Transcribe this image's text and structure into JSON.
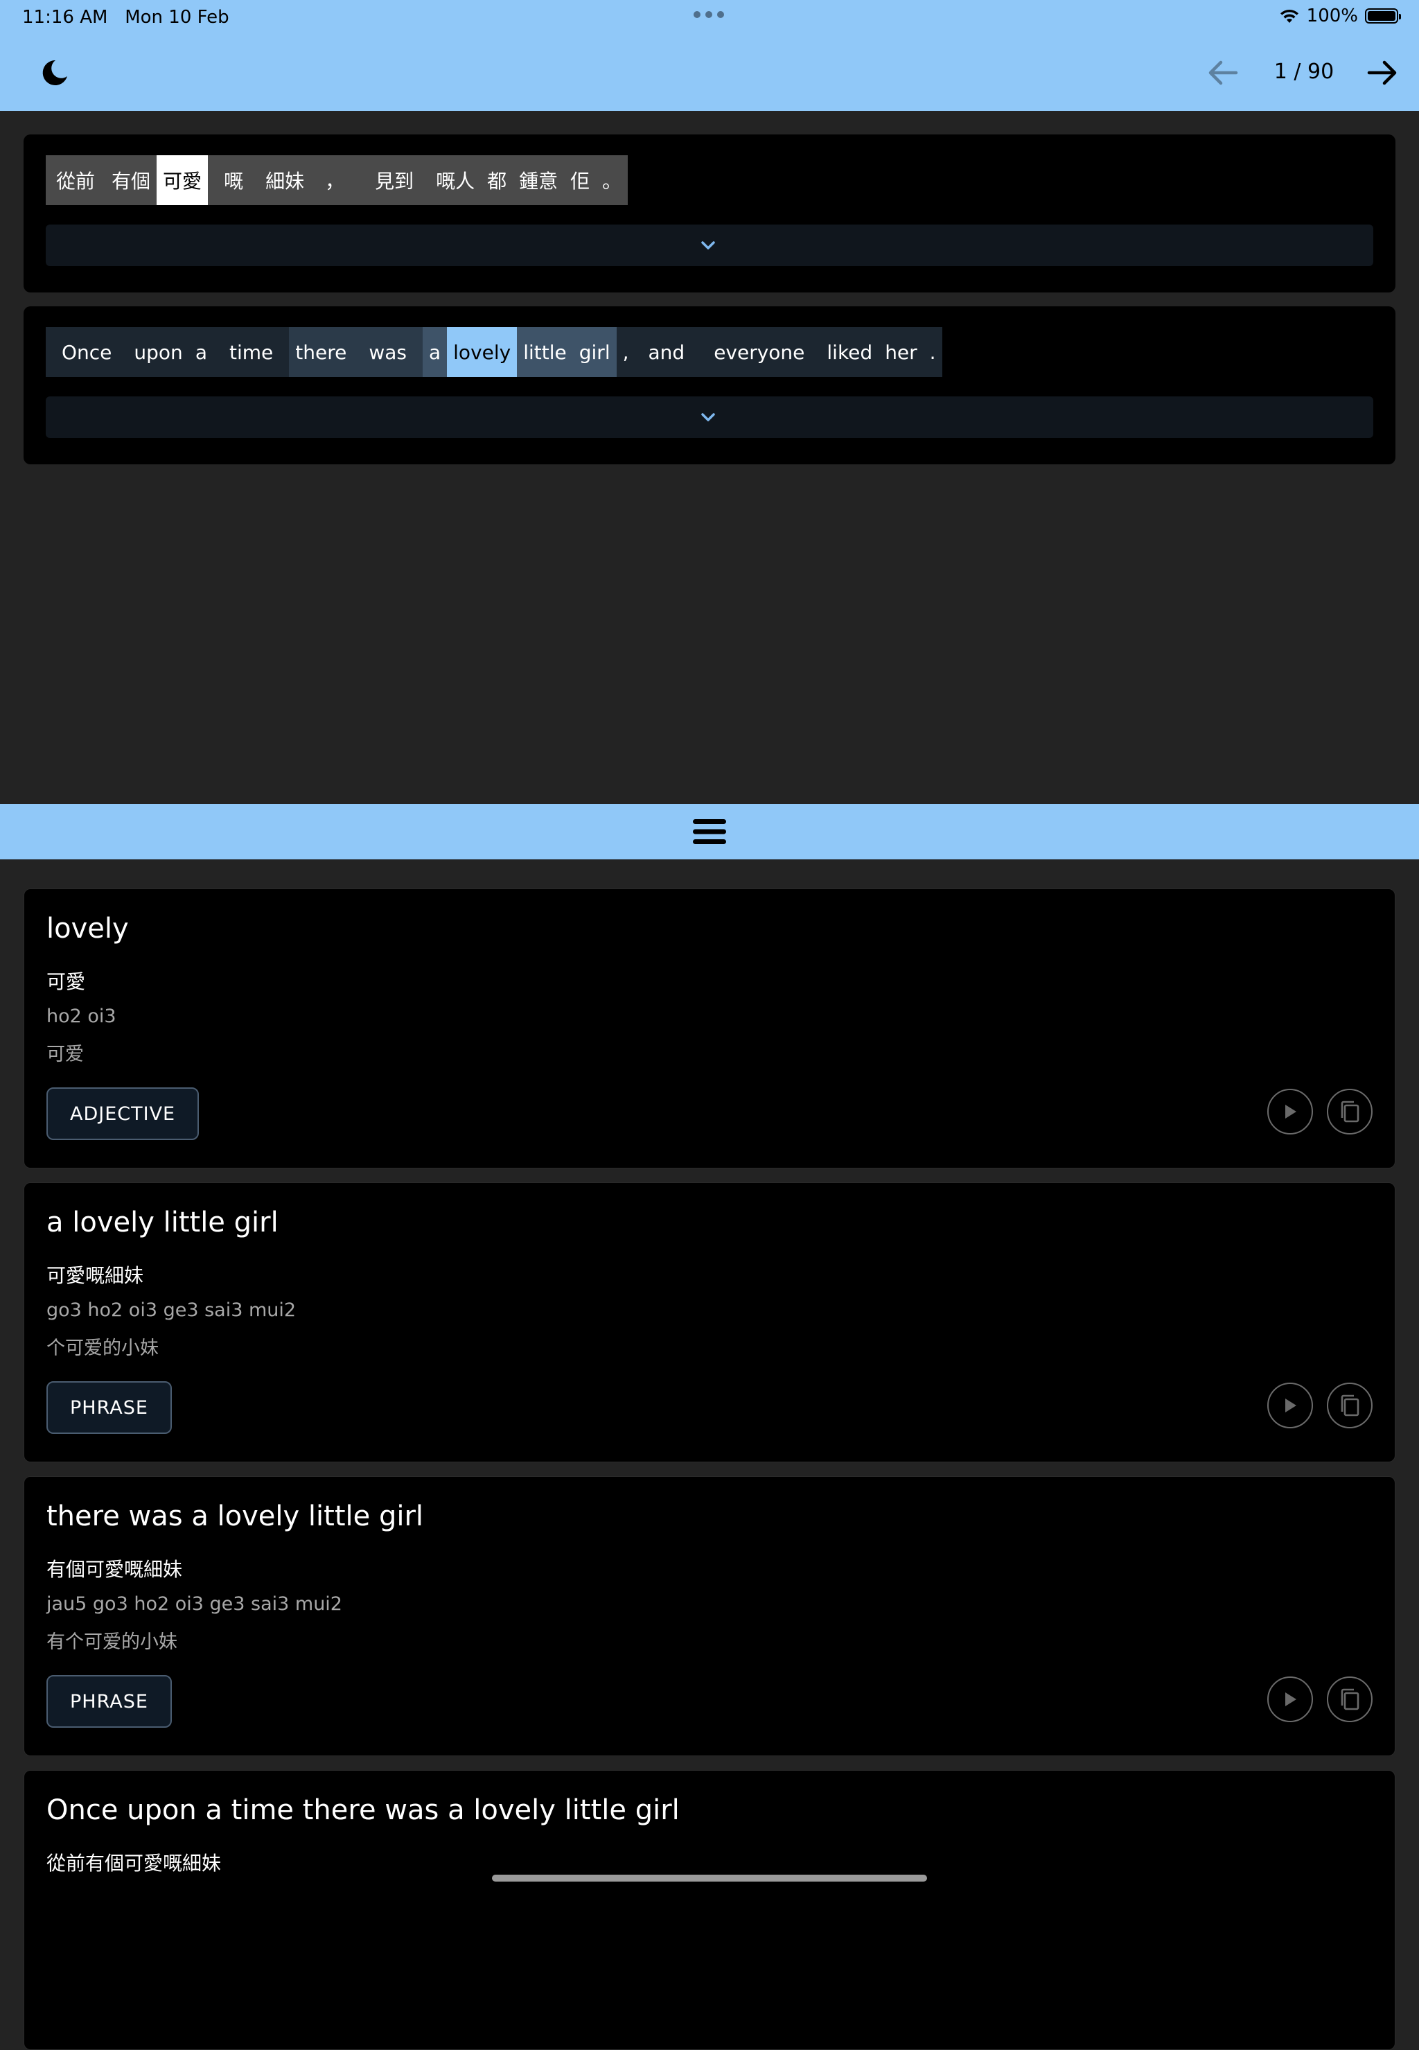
{
  "status_bar": {
    "time": "11:16 AM",
    "date": "Mon 10 Feb",
    "battery": "100%",
    "battery_level": 1.0
  },
  "header": {
    "theme_icon": "moon-icon",
    "prev_icon": "arrow-left-icon",
    "next_icon": "arrow-right-icon",
    "page_counter": "1 / 90"
  },
  "colors": {
    "accent": "#90c8f8",
    "card_bg": "#000000",
    "page_bg": "#232323"
  },
  "sentences": [
    {
      "tokens": [
        {
          "text": "從前",
          "bg": "#4a4a4a",
          "fg": "#ffffff"
        },
        {
          "text": "有個",
          "bg": "#4a4a4a",
          "fg": "#ffffff"
        },
        {
          "text": "可愛",
          "bg": "#ffffff",
          "fg": "#000000"
        },
        {
          "text": "嘅",
          "bg": "#4a4a4a",
          "fg": "#ffffff"
        },
        {
          "text": "細妹",
          "bg": "#4a4a4a",
          "fg": "#ffffff"
        },
        {
          "text": "，",
          "bg": "#4a4a4a",
          "fg": "#ffffff"
        },
        {
          "text": "見到",
          "bg": "#4a4a4a",
          "fg": "#ffffff"
        },
        {
          "text": "嘅人",
          "bg": "#4a4a4a",
          "fg": "#ffffff"
        },
        {
          "text": "都",
          "bg": "#4a4a4a",
          "fg": "#ffffff"
        },
        {
          "text": "鍾意",
          "bg": "#4a4a4a",
          "fg": "#ffffff"
        },
        {
          "text": "佢",
          "bg": "#4a4a4a",
          "fg": "#ffffff"
        },
        {
          "text": "。",
          "bg": "#4a4a4a",
          "fg": "#ffffff"
        }
      ]
    },
    {
      "tokens": [
        {
          "text": "Once",
          "bg": "#1c2630",
          "fg": "#ffffff"
        },
        {
          "text": "upon",
          "bg": "#1c2630",
          "fg": "#ffffff"
        },
        {
          "text": "a",
          "bg": "#1c2630",
          "fg": "#ffffff"
        },
        {
          "text": "time",
          "bg": "#1c2630",
          "fg": "#ffffff"
        },
        {
          "text": "there",
          "bg": "#2b3a49",
          "fg": "#ffffff"
        },
        {
          "text": "was",
          "bg": "#2b3a49",
          "fg": "#ffffff"
        },
        {
          "text": "a",
          "bg": "#3e5368",
          "fg": "#ffffff"
        },
        {
          "text": "lovely",
          "bg": "#90c8f8",
          "fg": "#000000"
        },
        {
          "text": "little",
          "bg": "#3e5368",
          "fg": "#ffffff"
        },
        {
          "text": "girl",
          "bg": "#3e5368",
          "fg": "#ffffff"
        },
        {
          "text": ",",
          "bg": "#1c2630",
          "fg": "#ffffff"
        },
        {
          "text": "and",
          "bg": "#1c2630",
          "fg": "#ffffff"
        },
        {
          "text": "everyone",
          "bg": "#1c2630",
          "fg": "#ffffff"
        },
        {
          "text": "liked",
          "bg": "#1c2630",
          "fg": "#ffffff"
        },
        {
          "text": "her",
          "bg": "#1c2630",
          "fg": "#ffffff"
        },
        {
          "text": ".",
          "bg": "#1c2630",
          "fg": "#ffffff"
        }
      ]
    }
  ],
  "definitions": [
    {
      "title": "lovely",
      "chinese": "可愛",
      "romanization": "ho2 oi3",
      "simplified": "可爱",
      "pos": "ADJECTIVE"
    },
    {
      "title": "a lovely little girl",
      "chinese": "可愛嘅細妹",
      "romanization": "go3 ho2 oi3 ge3 sai3 mui2",
      "simplified": "个可爱的小妹",
      "pos": "PHRASE"
    },
    {
      "title": "there was a lovely little girl",
      "chinese": "有個可愛嘅細妹",
      "romanization": "jau5 go3 ho2 oi3 ge3 sai3 mui2",
      "simplified": "有个可爱的小妹",
      "pos": "PHRASE"
    },
    {
      "title": "Once upon a time there was a lovely little girl",
      "chinese": "從前有個可愛嘅細妹",
      "romanization": "",
      "simplified": "",
      "pos": ""
    }
  ]
}
